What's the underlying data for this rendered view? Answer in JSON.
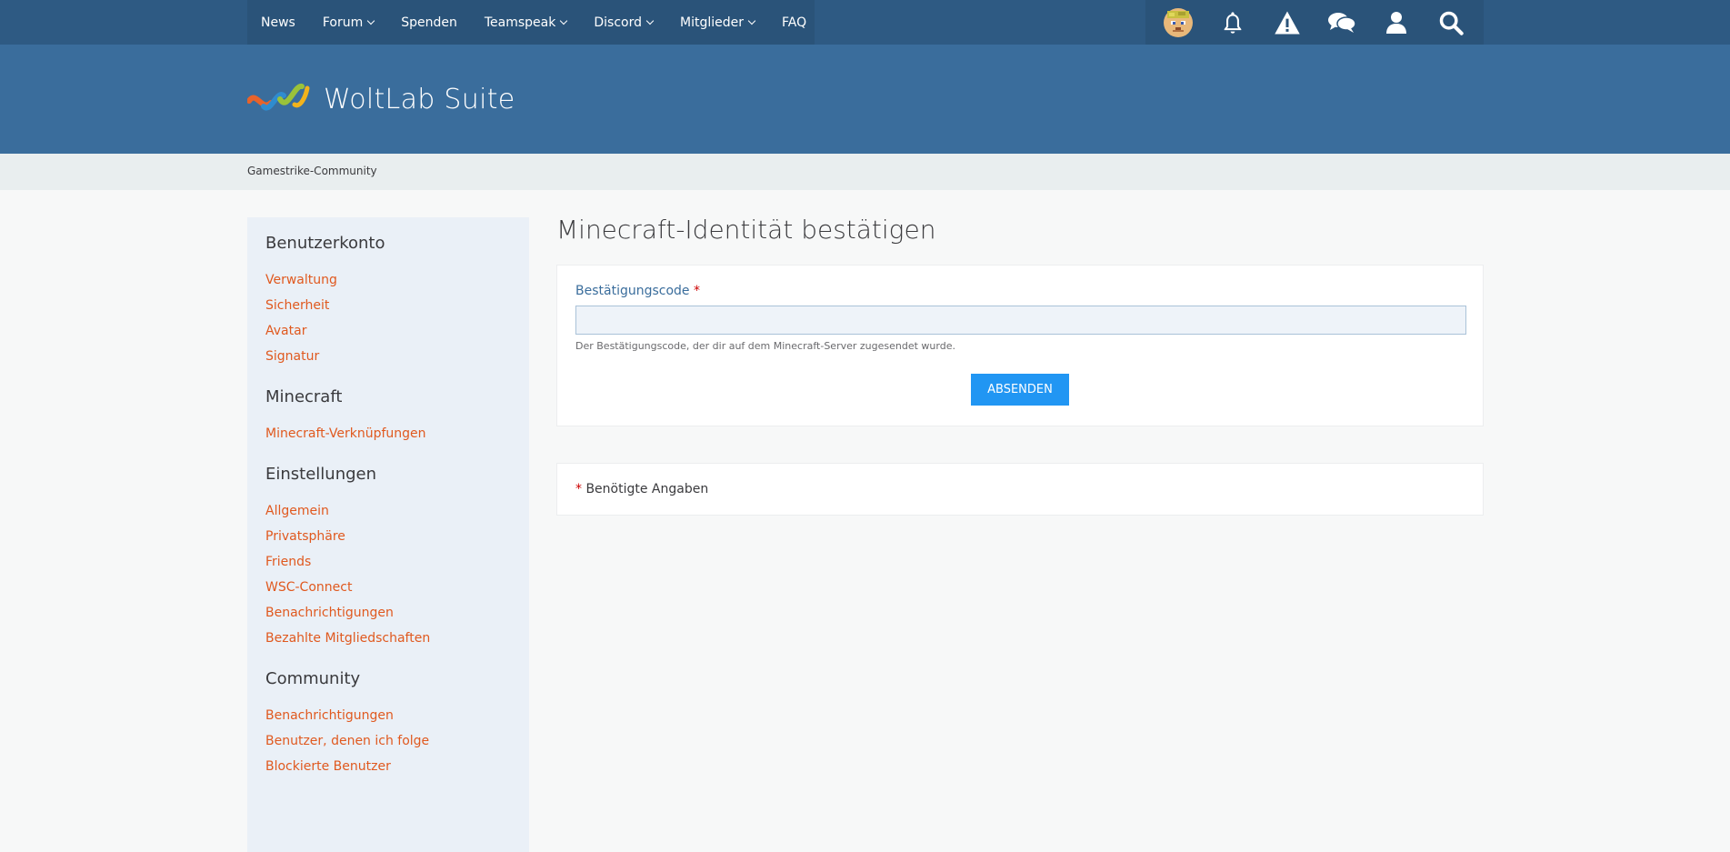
{
  "nav": {
    "items": [
      {
        "label": "News",
        "dropdown": false
      },
      {
        "label": "Forum",
        "dropdown": true
      },
      {
        "label": "Spenden",
        "dropdown": false
      },
      {
        "label": "Teamspeak",
        "dropdown": true
      },
      {
        "label": "Discord",
        "dropdown": true
      },
      {
        "label": "Mitglieder",
        "dropdown": true
      },
      {
        "label": "FAQ",
        "dropdown": false
      }
    ]
  },
  "usernav": {
    "icons": [
      "avatar",
      "bell-icon",
      "warning-icon",
      "conversations-icon",
      "user-icon",
      "search-icon"
    ]
  },
  "header": {
    "logo_text": "WoltLab Suite"
  },
  "breadcrumb": {
    "label": "Gamestrike-Community"
  },
  "sidebar": {
    "sections": [
      {
        "title": "Benutzerkonto",
        "items": [
          "Verwaltung",
          "Sicherheit",
          "Avatar",
          "Signatur"
        ]
      },
      {
        "title": "Minecraft",
        "items": [
          "Minecraft-Verknüpfungen"
        ]
      },
      {
        "title": "Einstellungen",
        "items": [
          "Allgemein",
          "Privatsphäre",
          "Friends",
          "WSC-Connect",
          "Benachrichtigungen",
          "Bezahlte Mitgliedschaften"
        ]
      },
      {
        "title": "Community",
        "items": [
          "Benachrichtigungen",
          "Benutzer, denen ich folge",
          "Blockierte Benutzer"
        ]
      }
    ]
  },
  "main": {
    "title": "Minecraft-Identität bestätigen",
    "form": {
      "label": "Bestätigungscode",
      "required_marker": "*",
      "value": "",
      "placeholder": "",
      "description": "Der Bestätigungscode, der dir auf dem Minecraft-Server zugesendet wurde.",
      "submit_label": "ABSENDEN"
    },
    "required_note": {
      "marker": "*",
      "text": "Benötigte Angaben"
    }
  },
  "colors": {
    "topbar": "#2e5a83",
    "header": "#3a6d9c",
    "link": "#e0591f",
    "button": "#2196f3"
  }
}
